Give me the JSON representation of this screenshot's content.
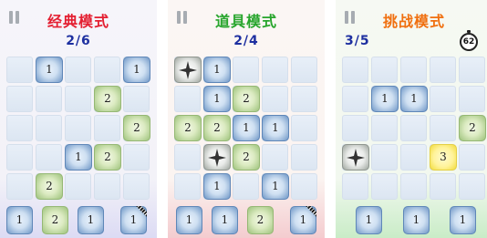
{
  "panels": [
    {
      "title": "经典模式",
      "progress": "2/6",
      "cols": [
        1,
        3,
        3,
        3,
        3
      ],
      "cells": [
        [
          null,
          {
            "v": "1",
            "c": "blue"
          },
          null,
          null,
          {
            "v": "1",
            "c": "blue"
          }
        ],
        [
          null,
          null,
          null,
          {
            "v": "2",
            "c": "green"
          },
          null
        ],
        [
          null,
          null,
          null,
          null,
          {
            "v": "2",
            "c": "green"
          }
        ],
        [
          null,
          null,
          {
            "v": "1",
            "c": "blue"
          },
          {
            "v": "2",
            "c": "green"
          },
          null
        ],
        [
          null,
          {
            "v": "2",
            "c": "green"
          },
          null,
          null,
          null
        ]
      ],
      "tray": [
        {
          "v": "1",
          "c": "blue"
        },
        {
          "v": "2",
          "c": "green"
        },
        {
          "v": "1",
          "c": "blue"
        },
        {
          "v": "1",
          "c": "blue",
          "ribbon": true
        }
      ]
    },
    {
      "title": "道具模式",
      "progress": "2/4",
      "cells": [
        [
          {
            "v": "star",
            "c": "gray"
          },
          {
            "v": "1",
            "c": "blue"
          },
          null,
          null,
          null
        ],
        [
          null,
          {
            "v": "1",
            "c": "blue"
          },
          {
            "v": "2",
            "c": "green"
          },
          null,
          null
        ],
        [
          {
            "v": "2",
            "c": "green"
          },
          {
            "v": "2",
            "c": "green"
          },
          {
            "v": "1",
            "c": "blue"
          },
          {
            "v": "1",
            "c": "blue"
          },
          null
        ],
        [
          null,
          {
            "v": "star",
            "c": "gray"
          },
          {
            "v": "2",
            "c": "green"
          },
          null,
          null
        ],
        [
          null,
          {
            "v": "1",
            "c": "blue"
          },
          null,
          {
            "v": "1",
            "c": "blue"
          },
          null
        ]
      ],
      "tray": [
        {
          "v": "1",
          "c": "blue"
        },
        {
          "v": "1",
          "c": "blue"
        },
        {
          "v": "2",
          "c": "green"
        },
        {
          "v": "1",
          "c": "blue",
          "ribbon": true
        }
      ]
    },
    {
      "title": "挑战模式",
      "progress": "3/5",
      "timer": "62",
      "cells": [
        [
          null,
          null,
          null,
          null,
          null
        ],
        [
          null,
          {
            "v": "1",
            "c": "blue"
          },
          {
            "v": "1",
            "c": "blue"
          },
          null,
          null
        ],
        [
          null,
          null,
          null,
          null,
          {
            "v": "2",
            "c": "green"
          }
        ],
        [
          {
            "v": "star",
            "c": "gray"
          },
          null,
          null,
          {
            "v": "3",
            "c": "yellow"
          },
          null
        ],
        [
          null,
          null,
          null,
          null,
          null
        ]
      ],
      "tray": [
        {
          "v": "1",
          "c": "blue"
        },
        {
          "v": "1",
          "c": "blue"
        },
        {
          "v": "1",
          "c": "blue"
        }
      ]
    }
  ],
  "icons": {
    "pause": "pause-icon",
    "star": "shuriken-icon",
    "timer": "stopwatch-icon"
  }
}
